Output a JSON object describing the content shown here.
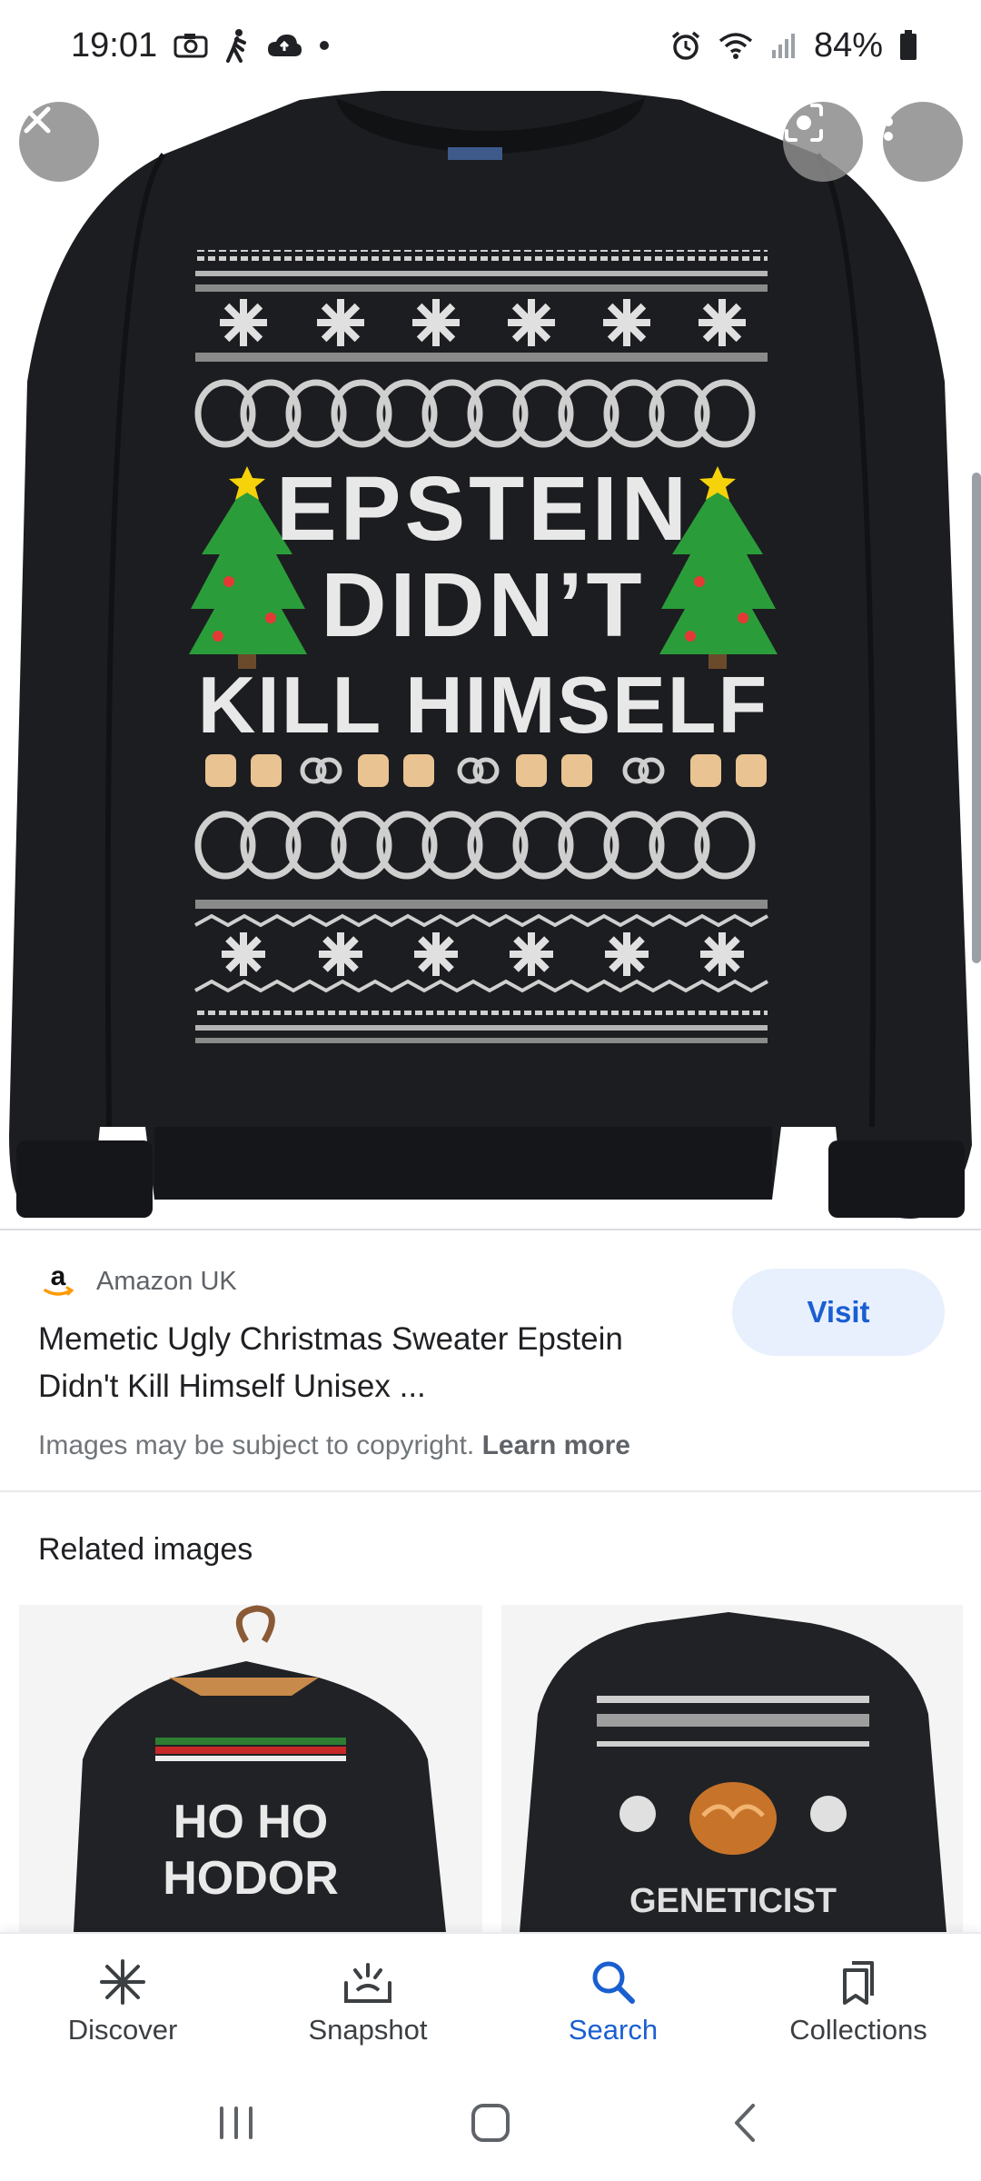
{
  "status_bar": {
    "time": "19:01",
    "battery": "84%",
    "left_icons": [
      "camera-icon",
      "walking-icon",
      "cloud-icon",
      "dot-icon"
    ],
    "right_icons": [
      "alarm-icon",
      "wifi-icon",
      "signal-icon",
      "battery-icon"
    ]
  },
  "hero": {
    "image_text": [
      "EPSTEIN",
      "DIDN’T",
      "KILL HIMSELF"
    ],
    "close_icon": "close-icon",
    "lens_icon": "lens-icon",
    "more_icon": "more-vert-icon"
  },
  "result": {
    "source_name": "Amazon UK",
    "source_logo": "a",
    "title": "Memetic Ugly Christmas Sweater Epstein Didn't Kill Himself Unisex ...",
    "visit_label": "Visit",
    "copyright_text": "Images may be subject to copyright.",
    "learn_more": "Learn more"
  },
  "related": {
    "title": "Related images",
    "thumbs": [
      {
        "lines": [
          "HO HO",
          "HODOR"
        ]
      },
      {
        "lines": [
          "GENETICIST"
        ]
      }
    ]
  },
  "bottom_nav": {
    "items": [
      {
        "label": "Discover",
        "icon": "asterisk-icon"
      },
      {
        "label": "Snapshot",
        "icon": "snapshot-icon"
      },
      {
        "label": "Search",
        "icon": "search-icon"
      },
      {
        "label": "Collections",
        "icon": "collections-icon"
      }
    ],
    "active": "Search"
  },
  "colors": {
    "accent": "#1a5fd1",
    "visit_bg": "#e8f0fe",
    "sweater": "#1c1d20"
  }
}
